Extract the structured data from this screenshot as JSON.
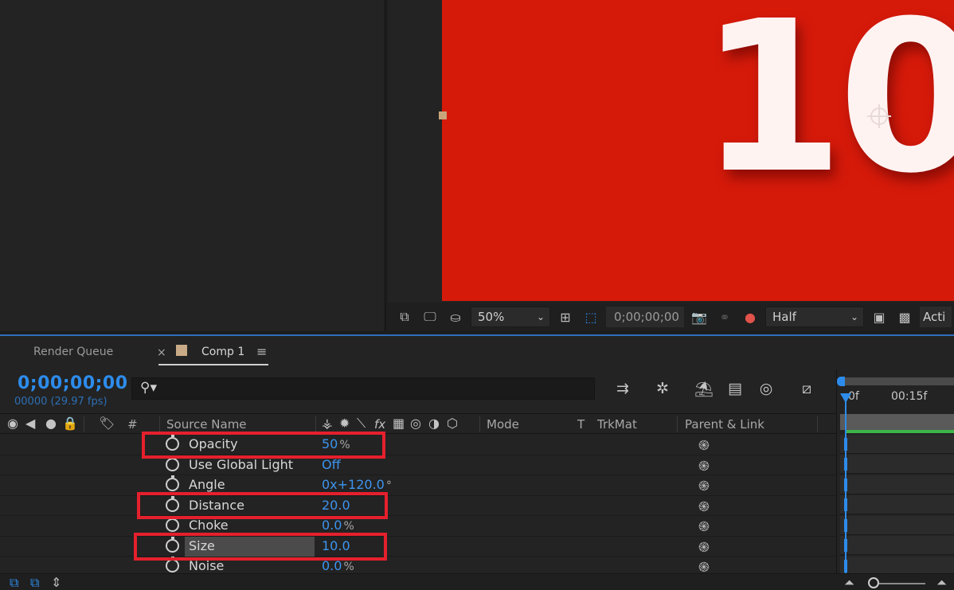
{
  "viewer": {
    "digits": "10",
    "toolbar": {
      "zoom": "50%",
      "timecode": "0;00;00;00",
      "resolution": "Half",
      "active_camera_cut": "Acti"
    }
  },
  "timeline": {
    "tabs": {
      "render_queue": "Render Queue",
      "close": "×",
      "comp": "Comp 1",
      "menu": "≡"
    },
    "timecode": "0;00;00;00",
    "fps": "00000 (29.97 fps)",
    "search": {
      "icon": "⚲▾",
      "placeholder": ""
    },
    "columns": {
      "hash": "#",
      "source_name": "Source Name",
      "fx": "fx",
      "mode": "Mode",
      "t": "T",
      "trkmat": "TrkMat",
      "parent_link": "Parent & Link"
    },
    "properties": [
      {
        "name": "Opacity",
        "value": "50",
        "unit": "%"
      },
      {
        "name": "Use Global Light",
        "value": "Off",
        "unit": ""
      },
      {
        "name": "Angle",
        "value": "0x+120.0",
        "unit": "°"
      },
      {
        "name": "Distance",
        "value": "20.0",
        "unit": ""
      },
      {
        "name": "Choke",
        "value": "0.0",
        "unit": "%"
      },
      {
        "name": "Size",
        "value": "10.0",
        "unit": ""
      },
      {
        "name": "Noise",
        "value": "0.0",
        "unit": "%"
      }
    ],
    "ruler": {
      "start": "0f",
      "mark": "00:15f"
    }
  },
  "colors": {
    "accent": "#2d8ceb",
    "canvas_red": "#d61a0a",
    "highlight_red": "#e5202d"
  }
}
